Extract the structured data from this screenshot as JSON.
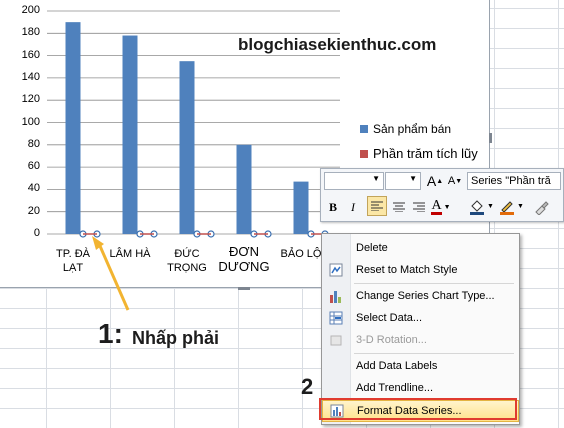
{
  "watermark": "blogchiasekienthuc.com",
  "chart_data": {
    "type": "bar",
    "categories": [
      "TP. ĐÀ LẠT",
      "LÂM HÀ",
      "ĐỨC TRỌNG",
      "ĐƠN DƯƠNG",
      "BẢO LỘC"
    ],
    "category_labels": [
      [
        "TP. ĐÀ",
        "LẠT"
      ],
      [
        "LÂM HÀ"
      ],
      [
        "ĐỨC",
        "TRỌNG"
      ],
      [
        "ĐƠN",
        "DƯƠNG"
      ],
      [
        "BẢO LỘ"
      ]
    ],
    "series": [
      {
        "name": "Sản phẩm bán",
        "values": [
          190,
          178,
          155,
          80,
          47
        ],
        "color": "#4f81bd"
      },
      {
        "name": "Phần trăm tích lũy",
        "values": [
          0,
          0,
          0,
          0,
          0
        ],
        "color": "#c0504d"
      }
    ],
    "ylim": [
      0,
      200
    ],
    "yticks": [
      "200",
      "180",
      "160",
      "140",
      "120",
      "100",
      "80",
      "60",
      "40",
      "20",
      "0"
    ],
    "grid": true,
    "legend_position": "right"
  },
  "minibar": {
    "series_select": "Series \"Phần tră",
    "grow_icon": "A",
    "shrink_icon": "A",
    "bold": "B",
    "italic": "I",
    "shape_fill_icon": "shape-fill-icon",
    "shape_outline_icon": "shape-outline-icon",
    "format_painter_icon": "format-painter-icon"
  },
  "context_menu": {
    "items": [
      {
        "label": "Delete",
        "icon": "none"
      },
      {
        "label": "Reset to Match Style",
        "icon": "reset-style-icon"
      },
      {
        "label": "Change Series Chart Type...",
        "icon": "chart-type-icon"
      },
      {
        "label": "Select Data...",
        "icon": "select-data-icon"
      },
      {
        "label": "3-D Rotation...",
        "icon": "rotation-icon",
        "disabled": true
      },
      {
        "label": "Add Data Labels",
        "icon": "none"
      },
      {
        "label": "Add Trendline...",
        "icon": "none"
      },
      {
        "label": "Format Data Series...",
        "icon": "format-series-icon",
        "highlighted": true
      }
    ]
  },
  "annotations": {
    "step1_number": "1",
    "step1_colon": ":",
    "step1_text": "Nhấp phải",
    "step2_number": "2",
    "arrow_color": "#f2b431",
    "box_color": "#e03b2f"
  }
}
